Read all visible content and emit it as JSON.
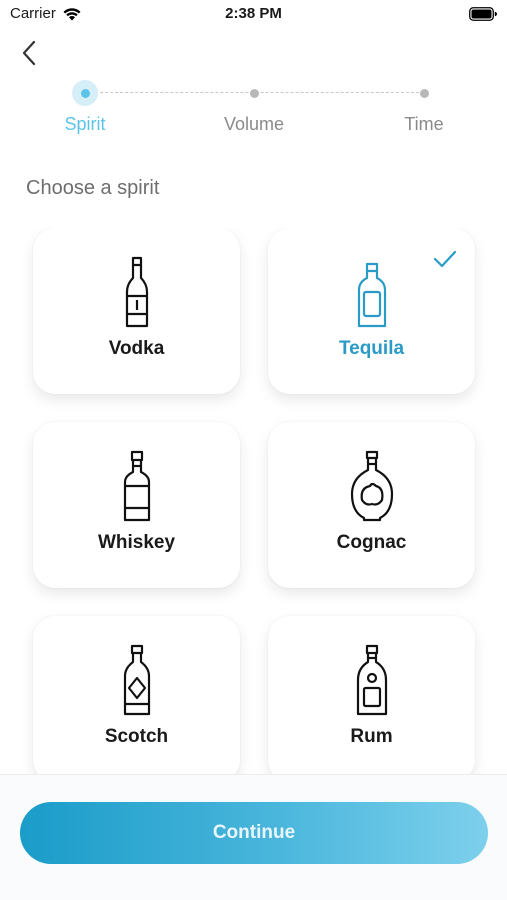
{
  "status_bar": {
    "carrier": "Carrier",
    "time": "2:38 PM"
  },
  "stepper": {
    "steps": [
      {
        "label": "Spirit",
        "active": true
      },
      {
        "label": "Volume",
        "active": false
      },
      {
        "label": "Time",
        "active": false
      }
    ]
  },
  "section_title": "Choose a spirit",
  "spirits": [
    {
      "name": "Vodka",
      "icon": "vodka-bottle-icon",
      "selected": false
    },
    {
      "name": "Tequila",
      "icon": "tequila-bottle-icon",
      "selected": true
    },
    {
      "name": "Whiskey",
      "icon": "whiskey-bottle-icon",
      "selected": false
    },
    {
      "name": "Cognac",
      "icon": "cognac-bottle-icon",
      "selected": false
    },
    {
      "name": "Scotch",
      "icon": "scotch-bottle-icon",
      "selected": false
    },
    {
      "name": "Rum",
      "icon": "rum-bottle-icon",
      "selected": false
    }
  ],
  "continue_label": "Continue",
  "colors": {
    "accent": "#5bc4e8",
    "selected_text": "#2a9bc6",
    "button_start": "#1a9cc9",
    "button_end": "#7dd0ec"
  }
}
